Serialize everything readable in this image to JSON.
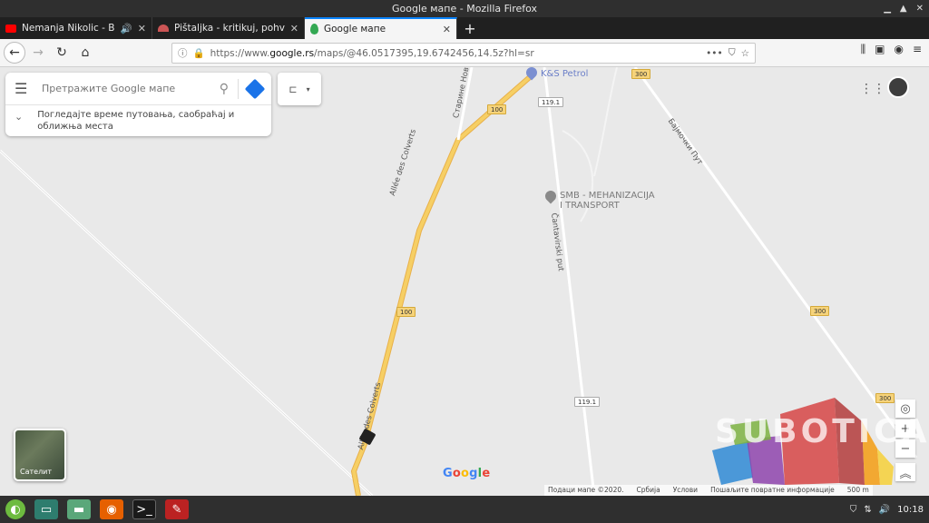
{
  "window": {
    "title": "Google мапе - Mozilla Firefox"
  },
  "tabs": [
    {
      "label": "Nemanja Nikolic - Bebo"
    },
    {
      "label": "Pištaljka - kritikuj, pohvali, u"
    },
    {
      "label": "Google мапе"
    }
  ],
  "url": {
    "prefix": "https://www.",
    "domain": "google.rs",
    "path": "/maps/@46.0517395,19.6742456,14.5z?hl=sr"
  },
  "search": {
    "placeholder": "Претражите Google мапе"
  },
  "travel": {
    "text": "Погледајте време путовања, саобраћај и оближња места"
  },
  "pois": {
    "petrol": "K&S Petrol",
    "smb_line1": "SMB - MEHANIZACIJA",
    "smb_line2": "I TRANSPORT"
  },
  "roads": {
    "r100": "100",
    "r300": "300",
    "r1191": "119.1",
    "allee": "Allée des Colverts",
    "staro": "Старине Новак",
    "sebesic": "Бајмочки Пут",
    "cantavir": "Čantavirski put"
  },
  "satellite": {
    "label": "Сателит"
  },
  "footer": {
    "data": "Подаци мапе ©2020.",
    "country": "Србија",
    "terms": "Услови",
    "feedback": "Пошаљите повратне информације",
    "scale": "500 m"
  },
  "watermark": {
    "text": "SUBOTICA"
  },
  "taskbar": {
    "time": "10:18"
  }
}
